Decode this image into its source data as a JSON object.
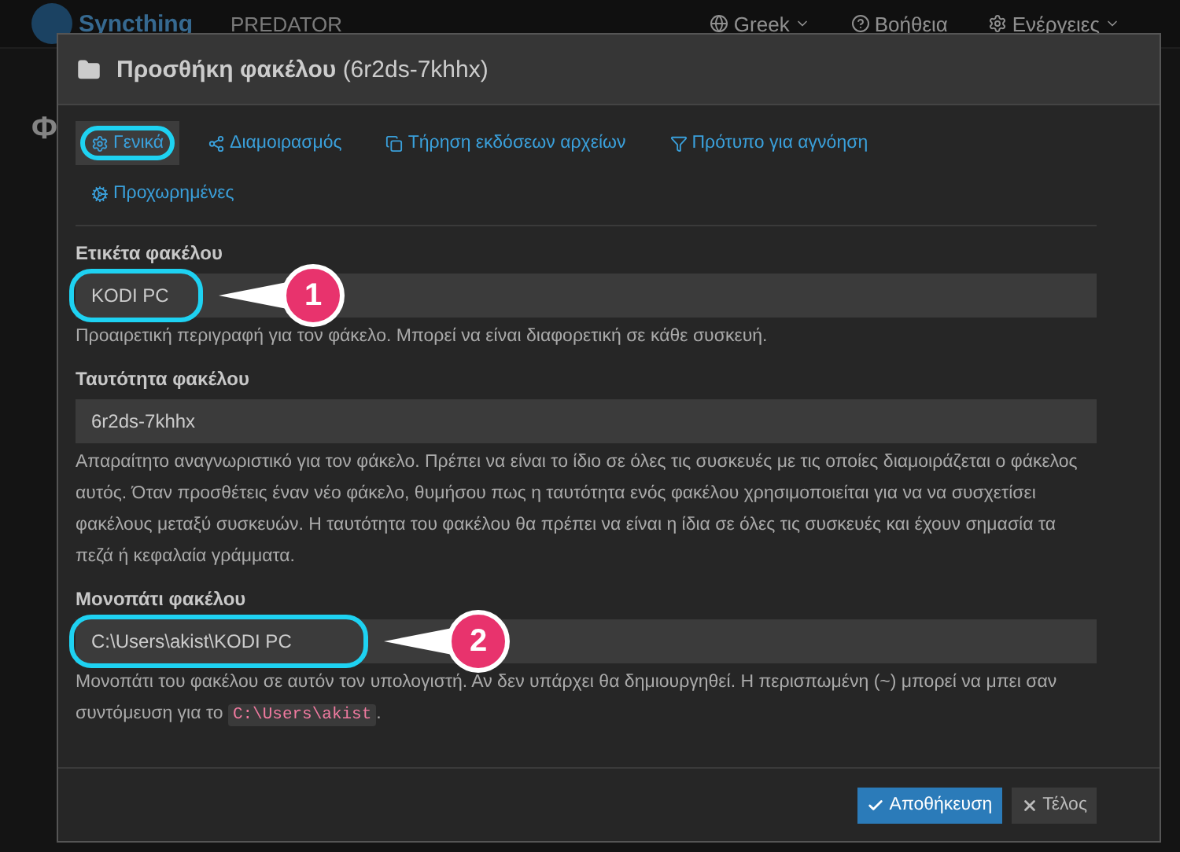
{
  "navbar": {
    "brand": "Syncthing",
    "device": "PREDATOR",
    "menus": [
      {
        "label": "Greek"
      },
      {
        "label": "Βοήθεια"
      },
      {
        "label": "Ενέργειες"
      }
    ]
  },
  "page": {
    "heading": "Φ"
  },
  "dialog": {
    "title": "Προσθήκη φακέλου",
    "subtitle": "(6r2ds-7khhx)",
    "tabs": [
      {
        "label": "Γενικά",
        "selected": true,
        "highlighted": true
      },
      {
        "label": "Διαμοιρασμός",
        "selected": false,
        "highlighted": false
      },
      {
        "label": "Τήρηση εκδόσεων αρχείων",
        "selected": false,
        "highlighted": false
      },
      {
        "label": "Πρότυπο για αγνόηση",
        "selected": false,
        "highlighted": false
      },
      {
        "label": "Προχωρημένες",
        "selected": false,
        "highlighted": false
      }
    ],
    "fields": [
      {
        "label": "Ετικέτα φακέλου",
        "value": "KODI PC",
        "highlighted": true,
        "callout": "1",
        "help": "Προαιρετική περιγραφή για τον φάκελο. Μπορεί να είναι διαφορετική σε κάθε συσκευή."
      },
      {
        "label": "Ταυτότητα φακέλου",
        "value": "6r2ds-7khhx",
        "highlighted": false,
        "help": "Απαραίτητο αναγνωριστικό για τον φάκελο. Πρέπει να είναι το ίδιο σε όλες τις συσκευές με τις οποίες διαμοιράζεται ο φάκελος αυτός. Όταν προσθέτεις έναν νέο φάκελο, θυμήσου πως η ταυτότητα ενός φακέλου χρησιμοποιείται για να να συσχετίσει φακέλους μεταξύ συσκευών. Η ταυτότητα του φακέλου θα πρέπει να είναι η ίδια σε όλες τις συσκευές και έχουν σημασία τα πεζά ή κεφαλαία γράμματα."
      },
      {
        "label": "Μονοπάτι φακέλου",
        "value": "C:\\Users\\akist\\KODI PC",
        "highlighted": true,
        "callout": "2",
        "help": "Μονοπάτι του φακέλου σε αυτόν τον υπολογιστή. Αν δεν υπάρχει θα δημιουργηθεί. Η περισπωμένη (~) μπορεί να μπει σαν συντόμευση για το",
        "help_code": "C:\\Users\\akist",
        "help_end": "."
      }
    ],
    "buttons": [
      {
        "label": "Αποθήκευση",
        "kind": "primary"
      },
      {
        "label": "Τέλος",
        "kind": "close"
      }
    ]
  }
}
